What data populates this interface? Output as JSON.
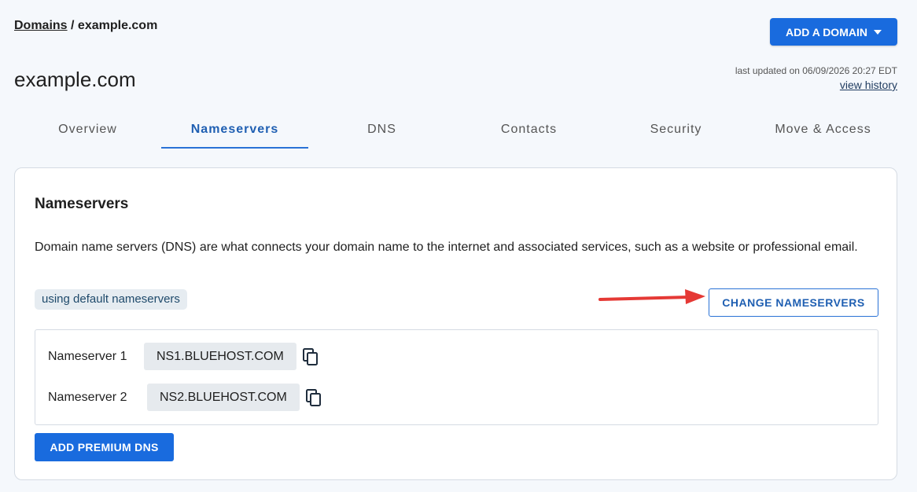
{
  "breadcrumb": {
    "root": "Domains",
    "separator": " / ",
    "current": "example.com"
  },
  "header": {
    "add_domain_label": "ADD A DOMAIN",
    "title": "example.com",
    "last_updated": "last updated on 06/09/2026 20:27 EDT",
    "view_history": "view history"
  },
  "tabs": [
    {
      "label": "Overview",
      "active": false
    },
    {
      "label": "Nameservers",
      "active": true
    },
    {
      "label": "DNS",
      "active": false
    },
    {
      "label": "Contacts",
      "active": false
    },
    {
      "label": "Security",
      "active": false
    },
    {
      "label": "Move & Access",
      "active": false
    }
  ],
  "card": {
    "title": "Nameservers",
    "description": "Domain name servers (DNS) are what connects your domain name to the internet and associated services, such as a website or professional email.",
    "badge": "using default nameservers",
    "change_button": "CHANGE NAMESERVERS",
    "nameservers": [
      {
        "label": "Nameserver 1",
        "value": "NS1.BLUEHOST.COM",
        "icon": "copy-icon"
      },
      {
        "label": "Nameserver 2",
        "value": "NS2.BLUEHOST.COM",
        "icon": "copy-icon"
      }
    ],
    "premium_button": "ADD PREMIUM DNS"
  },
  "colors": {
    "primary": "#196bde",
    "annotation_arrow": "#e53935",
    "background": "#f5f8fc"
  }
}
